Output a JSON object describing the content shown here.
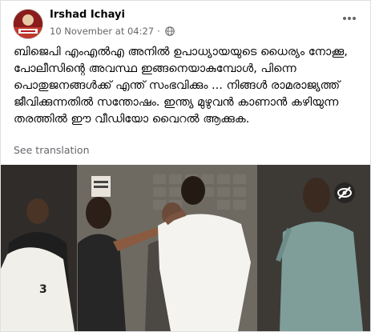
{
  "post": {
    "author_name": "Irshad Ichayi",
    "timestamp": "10 November at 04:27",
    "separator": "·",
    "privacy_icon": "globe-icon",
    "menu_icon": "more-options-icon",
    "text": "ബിജെപി എംഎൽഎ അനിൽ ഉപാധ്യായയുടെ ധൈര്യം നോക്കൂ, പോലീസിന്റെ അവസ്ഥ ഇങ്ങനെയാകുമ്പോൾ, പിന്നെ പൊതുജനങ്ങൾക്ക് എന്ത് സംഭവിക്കും ... നിങ്ങൾ രാമരാജ്യത്ത് ജീവിക്കുന്നതിൽ സന്തോഷം. ഇന്ത്യ മുഴുവൻ കാണാൻ കഴിയുന്ന തരത്തിൽ ഈ വീഡിയോ വൈറൽ ആക്കുക.",
    "see_translation": "See translation"
  },
  "video": {
    "sign_text": "NO ENTRY",
    "jersey_number": "3",
    "overlay_icon": "hidden-eye-icon"
  },
  "colors": {
    "author_text": "#050505",
    "meta_text": "#65676b",
    "card_bg": "#ffffff",
    "page_bg": "#f0f2f5"
  }
}
